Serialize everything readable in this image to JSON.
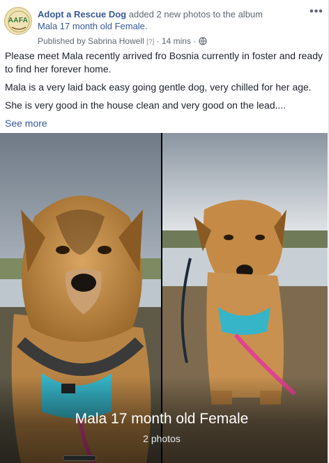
{
  "post": {
    "page_name": "Adopt a Rescue Dog",
    "action": " added 2 new photos to the album",
    "album_name": "Mala 17 month old Female.",
    "published_by": "Published by Sabrina Howell",
    "help_marker": "[?]",
    "time": "14 mins",
    "separator": "·",
    "more_icon": "more-options-icon",
    "privacy_icon": "globe-icon",
    "avatar_text": "AAFA",
    "paragraphs": [
      "Please meet Mala recently arrived fro Bosnia currently in foster and ready to find her forever home.",
      "Mala is a very laid back easy going gentle dog, very chilled for her age.",
      "She is very good in the house clean and very good on the lead...."
    ],
    "see_more": "See more"
  },
  "album": {
    "title": "Mala 17 month old Female",
    "count": "2 photos"
  },
  "colors": {
    "link": "#365899",
    "meta": "#606770",
    "text": "#1d2129",
    "harness": "#36b5c8",
    "leash": "#e0458f"
  }
}
